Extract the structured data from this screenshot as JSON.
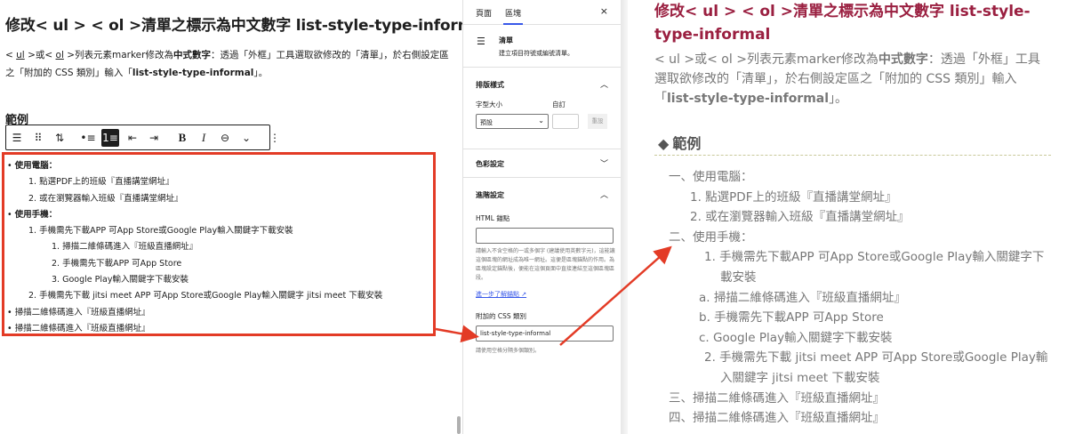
{
  "editor": {
    "title": "修改< ul > < ol >清單之標示為中文數字 list-style-type-informal",
    "desc_parts": [
      "<",
      "ul",
      " >或< ",
      "ol",
      " >列表元素marker修改為",
      "中式數字",
      "：透過「外框」工具選取欲修改的「清單」，於右側設定區之「附加的 CSS 類別」輸入「",
      "list-style-type-informal",
      "」。"
    ],
    "example_heading": "範例",
    "toolbar": {
      "list_icon": "☰",
      "drag_icon": "⠿",
      "move_icon": "⇅",
      "unordered_icon": "•≡",
      "ordered_icon": "1≡",
      "outdent_icon": "⇤",
      "indent_icon": "⇥",
      "bold": "B",
      "italic": "I",
      "link_icon": "⊖",
      "more_icon": "⌄",
      "options_icon": "⋮"
    },
    "list": [
      {
        "level": 0,
        "marker": "•",
        "text": "使用電腦：",
        "bold": true
      },
      {
        "level": 1,
        "marker": "1.",
        "text": "點選PDF上的班級『直播講堂網址』"
      },
      {
        "level": 1,
        "marker": "2.",
        "text": "或在瀏覽器輸入班級『直播講堂網址』"
      },
      {
        "level": 0,
        "marker": "•",
        "text": "使用手機：",
        "bold": true
      },
      {
        "level": 1,
        "marker": "1.",
        "text": "手機需先下載APP 可App Store或Google Play輸入關鍵字下載安裝"
      },
      {
        "level": 2,
        "marker": "1.",
        "text": "掃描二維條碼進入『班級直播網址』"
      },
      {
        "level": 2,
        "marker": "2.",
        "text": "手機需先下載APP 可App Store"
      },
      {
        "level": 2,
        "marker": "3.",
        "text": "Google Play輸入關鍵字下載安裝"
      },
      {
        "level": 1,
        "marker": "2.",
        "text": "手機需先下載 jitsi meet APP 可App Store或Google Play輸入關鍵字 jitsi meet 下載安裝"
      },
      {
        "level": 0,
        "marker": "•",
        "text": "掃描二維條碼進入『班級直播網址』"
      },
      {
        "level": 0,
        "marker": "•",
        "text": "掃描二維條碼進入『班級直播網址』"
      }
    ]
  },
  "sidebar": {
    "tab_page": "頁面",
    "tab_block": "區塊",
    "close": "×",
    "block_icon": "☰",
    "block_name": "清單",
    "block_desc": "建立項目符號或編號清單。",
    "typography_title": "排版樣式",
    "font_size_label": "字型大小",
    "custom_label": "自訂",
    "font_size_value": "預設",
    "reset_label": "重設",
    "color_title": "色彩設定",
    "advanced_title": "進階設定",
    "html_anchor_label": "HTML 錨點",
    "html_anchor_help": "請輸入不含空格的一或多個字 (建議使用英數字元)，這能讓這個區塊的網址成為唯一網址。這便是區塊錨點的作用。為區塊設定錨點後，便能在這個頁面中直接連結至這個區塊區段。",
    "learn_more": "進一步了解錨點 ↗",
    "css_class_label": "附加的 CSS 類別",
    "css_class_value": "list-style-type-informal",
    "css_class_help": "請使用空格分隔多個類別。"
  },
  "preview": {
    "title": "修改< ul > < ol >清單之標示為中文數字 list-style-type-informal",
    "desc_before": "< ul >或< ol >列表元素marker修改為",
    "desc_bold": "中式數字",
    "desc_middle": "：透過「外框」工具選取欲修改的「清單」，於右側設定區之「附加的 CSS 類別」輸入「",
    "desc_code": "list-style-type-informal",
    "desc_after": "」。",
    "heading_marker": "◆",
    "heading": "範例",
    "list": [
      {
        "cls": "l0",
        "text": "一、使用電腦："
      },
      {
        "cls": "l1",
        "text": "1. 點選PDF上的班級『直播講堂網址』"
      },
      {
        "cls": "l1",
        "text": "2. 或在瀏覽器輸入班級『直播講堂網址』"
      },
      {
        "cls": "l0",
        "text": "二、使用手機："
      },
      {
        "cls": "l1",
        "text": "1. 手機需先下載APP 可App Store或Google Play輸入關鍵字下載安裝"
      },
      {
        "cls": "l2",
        "text": "a. 掃描二維條碼進入『班級直播網址』"
      },
      {
        "cls": "l2",
        "text": "b. 手機需先下載APP 可App Store"
      },
      {
        "cls": "l2",
        "text": "c. Google Play輸入關鍵字下載安裝"
      },
      {
        "cls": "l1",
        "text": "2. 手機需先下載 jitsi meet APP 可App Store或Google Play輸入關鍵字 jitsi meet 下載安裝"
      },
      {
        "cls": "l0",
        "text": "三、掃描二維條碼進入『班級直播網址』"
      },
      {
        "cls": "l0",
        "text": "四、掃描二維條碼進入『班級直播網址』"
      }
    ]
  },
  "colors": {
    "highlight": "#e33b26",
    "preview_title": "#9a1f40",
    "accent": "#3858e9"
  }
}
